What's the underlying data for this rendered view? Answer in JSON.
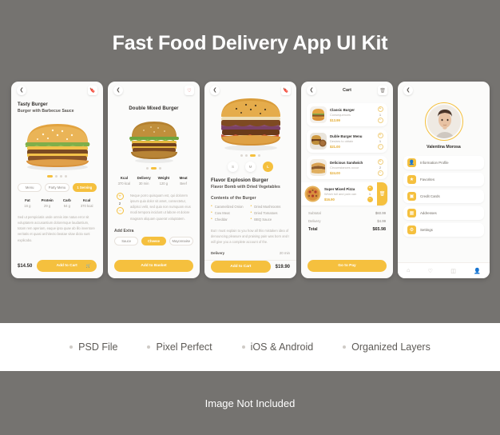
{
  "kit": {
    "title": "Fast Food Delivery App UI Kit",
    "footer_text": "Image Not Included",
    "accent_color": "#F5C03E",
    "background_color": "#757370"
  },
  "features": [
    {
      "label": "PSD File"
    },
    {
      "label": "Pixel Perfect"
    },
    {
      "label": "iOS & Android"
    },
    {
      "label": "Organized Layers"
    }
  ],
  "screens": {
    "detail": {
      "back_icon": "chevron-left-icon",
      "bookmark_icon": "bookmark-icon",
      "title": "Tasty Burger",
      "subtitle": "Burger with Barbecue Sauce",
      "tabs": [
        {
          "label": "Menu",
          "selected": false
        },
        {
          "label": "Party Menu",
          "selected": false
        },
        {
          "label": "1 Serving",
          "selected": true
        }
      ],
      "stats": [
        {
          "key": "Fat",
          "value": "16 g"
        },
        {
          "key": "Protein",
          "value": "29 g"
        },
        {
          "key": "Carb",
          "value": "64 g"
        },
        {
          "key": "Kcal",
          "value": "370 kcal"
        }
      ],
      "description": "Sed ut perspiciatis unde omnis iste natus error sit voluptatem accusantium doloremque laudantium, totam rem aperiam, eaque ipsa quae ab illo inventore veritatis et quasi architecto beatae vitae dicta sunt explicabo.",
      "price": "$14.50",
      "cta_label": "Add to Cart",
      "cta_icon": "cart-icon"
    },
    "customize": {
      "back_icon": "chevron-left-icon",
      "like_icon": "heart-icon",
      "title": "Double Mixed Burger",
      "stats": [
        {
          "key": "Kcal",
          "value": "370 kcal"
        },
        {
          "key": "Delivery",
          "value": "30 min"
        },
        {
          "key": "Weight",
          "value": "120 g"
        },
        {
          "key": "Meat",
          "value": "Beef"
        }
      ],
      "quantity": "2",
      "plus_icon": "plus-icon",
      "minus_icon": "minus-icon",
      "description": "Neque porro quisquam est, qui dolorem ipsum quia dolor sit amet, consectetur, adipisci velit, sed quia non numquam eius modi tempora incidunt ut labore et dolore magnam aliquam quaerat voluptatem.",
      "extras_heading": "Add Extra",
      "extras": [
        {
          "label": "Sauce",
          "selected": false
        },
        {
          "label": "Cheese",
          "selected": true
        },
        {
          "label": "Mayonnaise",
          "selected": false
        }
      ],
      "cta_label": "Add to Basket"
    },
    "contents": {
      "back_icon": "chevron-left-icon",
      "bookmark_icon": "bookmark-icon",
      "sizes": [
        {
          "label": "S",
          "selected": false
        },
        {
          "label": "M",
          "selected": false
        },
        {
          "label": "L",
          "selected": true
        }
      ],
      "title": "Flavor Explosion Burger",
      "subtitle": "Flavor Bomb with Dried Vegetables",
      "contents_heading": "Contents of the Burger",
      "ingredients": [
        "Caramelized Onion",
        "Dried Mushrooms",
        "Cow Meat",
        "Dried Tomatoes",
        "Cheddar",
        "BBQ Sauce"
      ],
      "description": "But I must explain to you how all this mistaken idea of denouncing pleasure and praising pain was born and I will give you a complete account of the.",
      "delivery_label": "Delivery",
      "delivery_value": "20 min",
      "cta_label": "Add to Cart",
      "price": "$19.90"
    },
    "cart": {
      "back_icon": "chevron-left-icon",
      "title": "Cart",
      "trash_icon": "trash-icon",
      "items": [
        {
          "name": "Classic Burger",
          "desc": "Consequences",
          "price": "$13.99",
          "qty": "1",
          "plus_icon": "plus-icon",
          "minus_icon": "minus-icon",
          "swiped": false
        },
        {
          "name": "Duble Burger Menu",
          "desc": "Desires to obtain",
          "price": "$21.00",
          "qty": "1",
          "plus_icon": "plus-icon",
          "minus_icon": "minus-icon",
          "swiped": false
        },
        {
          "name": "Delicious Sandwich",
          "desc": "Circumstances occur",
          "price": "$24.00",
          "qty": "2",
          "plus_icon": "plus-icon",
          "minus_icon": "minus-icon",
          "swiped": false
        },
        {
          "name": "Super Mixed Pizza",
          "desc": "Which toil and pain can",
          "price": "$16.90",
          "qty": "1",
          "plus_icon": "plus-icon",
          "minus_icon": "minus-icon",
          "swiped": true,
          "delete_icon": "trash-icon"
        }
      ],
      "totals": [
        {
          "label": "Subtotal",
          "value": "$60.99"
        },
        {
          "label": "Delivery",
          "value": "$4.99"
        }
      ],
      "grand_label": "Total",
      "grand_value": "$65.98",
      "cta_label": "Go to Pay"
    },
    "profile": {
      "back_icon": "chevron-left-icon",
      "avatar_icon": "avatar",
      "name": "Valentina Morosa",
      "menu": [
        {
          "label": "Information Profile",
          "icon": "user-icon"
        },
        {
          "label": "Favorites",
          "icon": "star-icon"
        },
        {
          "label": "Credit Cards",
          "icon": "card-icon"
        },
        {
          "label": "Addresses",
          "icon": "map-icon"
        },
        {
          "label": "Settings",
          "icon": "gear-icon"
        }
      ],
      "tabs": [
        {
          "icon": "home-icon",
          "active": false
        },
        {
          "icon": "heart-icon",
          "active": false
        },
        {
          "icon": "orders-icon",
          "active": false
        },
        {
          "icon": "profile-icon",
          "active": true
        }
      ]
    }
  }
}
